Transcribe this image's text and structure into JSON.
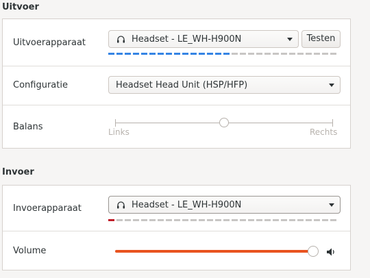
{
  "output": {
    "section_title": "Uitvoer",
    "device": {
      "label": "Uitvoerapparaat",
      "value": "Headset - LE_WH-H900N",
      "icon": "headset-icon",
      "test_button": "Testen",
      "level_fraction": 0.55
    },
    "config": {
      "label": "Configuratie",
      "value": "Headset Head Unit (HSP/HFP)"
    },
    "balance": {
      "label": "Balans",
      "left_label": "Links",
      "right_label": "Rechts",
      "value_fraction": 0.5
    }
  },
  "input": {
    "section_title": "Invoer",
    "device": {
      "label": "Invoerapparaat",
      "value": "Headset - LE_WH-H900N",
      "icon": "headset-icon",
      "level_fraction": 0.05
    },
    "volume": {
      "label": "Volume",
      "value_fraction": 1.0,
      "icon": "speaker-icon"
    }
  },
  "colors": {
    "accent": "#e95420",
    "level_active_output": "#3584e4",
    "level_active_input": "#c01c28",
    "level_inactive": "#c8c6c4"
  }
}
